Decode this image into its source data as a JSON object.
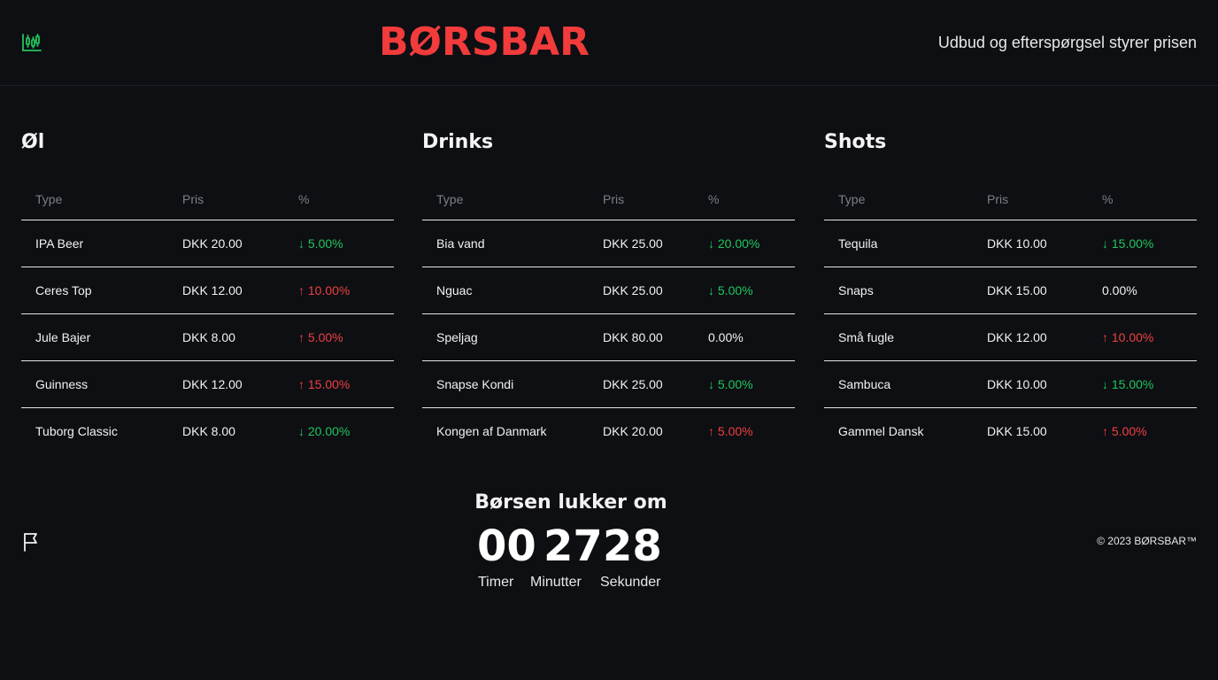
{
  "header": {
    "brand": "BØRSBAR",
    "tagline": "Udbud og efterspørgsel styrer prisen",
    "logo_icon": "candlestick-chart-icon",
    "brand_color": "#f23b3b",
    "accent_color": "#22c55e"
  },
  "markets": [
    {
      "title": "Øl",
      "columns": {
        "type": "Type",
        "price": "Pris",
        "change": "%"
      },
      "rows": [
        {
          "type": "IPA Beer",
          "price": "DKK 20.00",
          "change": "↓ 5.00%",
          "direction": "down"
        },
        {
          "type": "Ceres Top",
          "price": "DKK 12.00",
          "change": "↑ 10.00%",
          "direction": "up"
        },
        {
          "type": "Jule Bajer",
          "price": "DKK 8.00",
          "change": "↑ 5.00%",
          "direction": "up"
        },
        {
          "type": "Guinness",
          "price": "DKK 12.00",
          "change": "↑ 15.00%",
          "direction": "up"
        },
        {
          "type": "Tuborg Classic",
          "price": "DKK 8.00",
          "change": "↓ 20.00%",
          "direction": "down"
        }
      ]
    },
    {
      "title": "Drinks",
      "columns": {
        "type": "Type",
        "price": "Pris",
        "change": "%"
      },
      "rows": [
        {
          "type": "Bia vand",
          "price": "DKK 25.00",
          "change": "↓ 20.00%",
          "direction": "down"
        },
        {
          "type": "Nguac",
          "price": "DKK 25.00",
          "change": "↓ 5.00%",
          "direction": "down"
        },
        {
          "type": "Speljag",
          "price": "DKK 80.00",
          "change": "0.00%",
          "direction": "flat"
        },
        {
          "type": "Snapse Kondi",
          "price": "DKK 25.00",
          "change": "↓ 5.00%",
          "direction": "down"
        },
        {
          "type": "Kongen af Danmark",
          "price": "DKK 20.00",
          "change": "↑ 5.00%",
          "direction": "up"
        }
      ]
    },
    {
      "title": "Shots",
      "columns": {
        "type": "Type",
        "price": "Pris",
        "change": "%"
      },
      "rows": [
        {
          "type": "Tequila",
          "price": "DKK 10.00",
          "change": "↓ 15.00%",
          "direction": "down"
        },
        {
          "type": "Snaps",
          "price": "DKK 15.00",
          "change": "0.00%",
          "direction": "flat"
        },
        {
          "type": "Små fugle",
          "price": "DKK 12.00",
          "change": "↑ 10.00%",
          "direction": "up"
        },
        {
          "type": "Sambuca",
          "price": "DKK 10.00",
          "change": "↓ 15.00%",
          "direction": "down"
        },
        {
          "type": "Gammel Dansk",
          "price": "DKK 15.00",
          "change": "↑ 5.00%",
          "direction": "up"
        }
      ]
    }
  ],
  "countdown": {
    "title": "Børsen lukker om",
    "hours": "00",
    "minutes": "27",
    "seconds": "28",
    "hours_label": "Timer",
    "minutes_label": "Minutter",
    "seconds_label": "Sekunder"
  },
  "footer": {
    "flag_icon": "flag-icon",
    "copyright": "© 2023 BØRSBAR™"
  }
}
